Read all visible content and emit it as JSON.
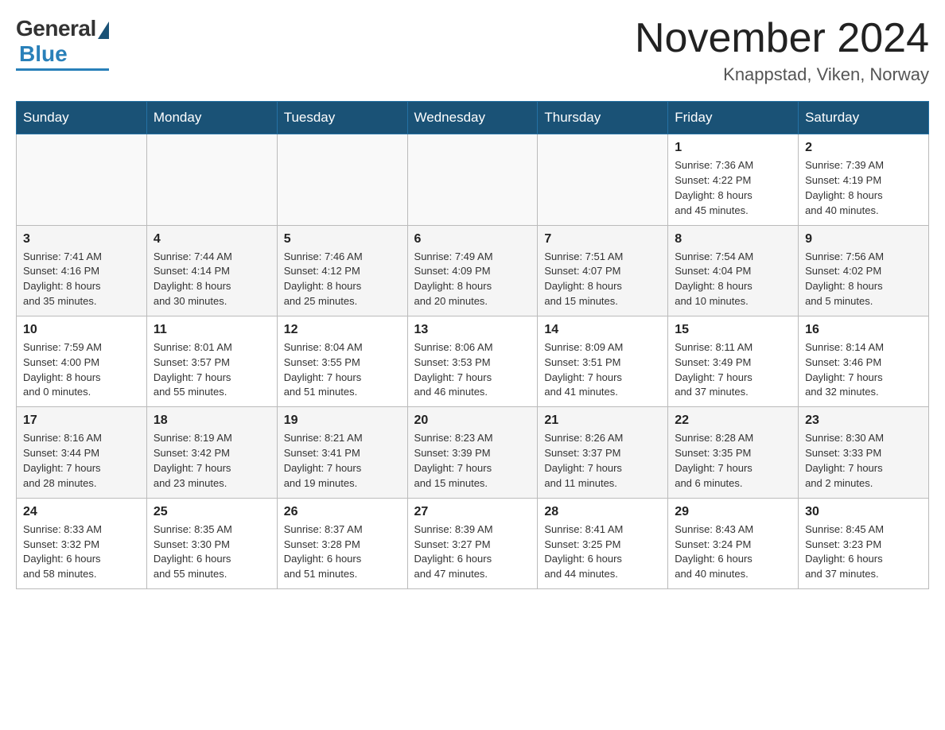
{
  "header": {
    "logo_general": "General",
    "logo_blue": "Blue",
    "month_title": "November 2024",
    "location": "Knappstad, Viken, Norway"
  },
  "weekdays": [
    "Sunday",
    "Monday",
    "Tuesday",
    "Wednesday",
    "Thursday",
    "Friday",
    "Saturday"
  ],
  "weeks": [
    [
      {
        "day": "",
        "info": ""
      },
      {
        "day": "",
        "info": ""
      },
      {
        "day": "",
        "info": ""
      },
      {
        "day": "",
        "info": ""
      },
      {
        "day": "",
        "info": ""
      },
      {
        "day": "1",
        "info": "Sunrise: 7:36 AM\nSunset: 4:22 PM\nDaylight: 8 hours\nand 45 minutes."
      },
      {
        "day": "2",
        "info": "Sunrise: 7:39 AM\nSunset: 4:19 PM\nDaylight: 8 hours\nand 40 minutes."
      }
    ],
    [
      {
        "day": "3",
        "info": "Sunrise: 7:41 AM\nSunset: 4:16 PM\nDaylight: 8 hours\nand 35 minutes."
      },
      {
        "day": "4",
        "info": "Sunrise: 7:44 AM\nSunset: 4:14 PM\nDaylight: 8 hours\nand 30 minutes."
      },
      {
        "day": "5",
        "info": "Sunrise: 7:46 AM\nSunset: 4:12 PM\nDaylight: 8 hours\nand 25 minutes."
      },
      {
        "day": "6",
        "info": "Sunrise: 7:49 AM\nSunset: 4:09 PM\nDaylight: 8 hours\nand 20 minutes."
      },
      {
        "day": "7",
        "info": "Sunrise: 7:51 AM\nSunset: 4:07 PM\nDaylight: 8 hours\nand 15 minutes."
      },
      {
        "day": "8",
        "info": "Sunrise: 7:54 AM\nSunset: 4:04 PM\nDaylight: 8 hours\nand 10 minutes."
      },
      {
        "day": "9",
        "info": "Sunrise: 7:56 AM\nSunset: 4:02 PM\nDaylight: 8 hours\nand 5 minutes."
      }
    ],
    [
      {
        "day": "10",
        "info": "Sunrise: 7:59 AM\nSunset: 4:00 PM\nDaylight: 8 hours\nand 0 minutes."
      },
      {
        "day": "11",
        "info": "Sunrise: 8:01 AM\nSunset: 3:57 PM\nDaylight: 7 hours\nand 55 minutes."
      },
      {
        "day": "12",
        "info": "Sunrise: 8:04 AM\nSunset: 3:55 PM\nDaylight: 7 hours\nand 51 minutes."
      },
      {
        "day": "13",
        "info": "Sunrise: 8:06 AM\nSunset: 3:53 PM\nDaylight: 7 hours\nand 46 minutes."
      },
      {
        "day": "14",
        "info": "Sunrise: 8:09 AM\nSunset: 3:51 PM\nDaylight: 7 hours\nand 41 minutes."
      },
      {
        "day": "15",
        "info": "Sunrise: 8:11 AM\nSunset: 3:49 PM\nDaylight: 7 hours\nand 37 minutes."
      },
      {
        "day": "16",
        "info": "Sunrise: 8:14 AM\nSunset: 3:46 PM\nDaylight: 7 hours\nand 32 minutes."
      }
    ],
    [
      {
        "day": "17",
        "info": "Sunrise: 8:16 AM\nSunset: 3:44 PM\nDaylight: 7 hours\nand 28 minutes."
      },
      {
        "day": "18",
        "info": "Sunrise: 8:19 AM\nSunset: 3:42 PM\nDaylight: 7 hours\nand 23 minutes."
      },
      {
        "day": "19",
        "info": "Sunrise: 8:21 AM\nSunset: 3:41 PM\nDaylight: 7 hours\nand 19 minutes."
      },
      {
        "day": "20",
        "info": "Sunrise: 8:23 AM\nSunset: 3:39 PM\nDaylight: 7 hours\nand 15 minutes."
      },
      {
        "day": "21",
        "info": "Sunrise: 8:26 AM\nSunset: 3:37 PM\nDaylight: 7 hours\nand 11 minutes."
      },
      {
        "day": "22",
        "info": "Sunrise: 8:28 AM\nSunset: 3:35 PM\nDaylight: 7 hours\nand 6 minutes."
      },
      {
        "day": "23",
        "info": "Sunrise: 8:30 AM\nSunset: 3:33 PM\nDaylight: 7 hours\nand 2 minutes."
      }
    ],
    [
      {
        "day": "24",
        "info": "Sunrise: 8:33 AM\nSunset: 3:32 PM\nDaylight: 6 hours\nand 58 minutes."
      },
      {
        "day": "25",
        "info": "Sunrise: 8:35 AM\nSunset: 3:30 PM\nDaylight: 6 hours\nand 55 minutes."
      },
      {
        "day": "26",
        "info": "Sunrise: 8:37 AM\nSunset: 3:28 PM\nDaylight: 6 hours\nand 51 minutes."
      },
      {
        "day": "27",
        "info": "Sunrise: 8:39 AM\nSunset: 3:27 PM\nDaylight: 6 hours\nand 47 minutes."
      },
      {
        "day": "28",
        "info": "Sunrise: 8:41 AM\nSunset: 3:25 PM\nDaylight: 6 hours\nand 44 minutes."
      },
      {
        "day": "29",
        "info": "Sunrise: 8:43 AM\nSunset: 3:24 PM\nDaylight: 6 hours\nand 40 minutes."
      },
      {
        "day": "30",
        "info": "Sunrise: 8:45 AM\nSunset: 3:23 PM\nDaylight: 6 hours\nand 37 minutes."
      }
    ]
  ]
}
